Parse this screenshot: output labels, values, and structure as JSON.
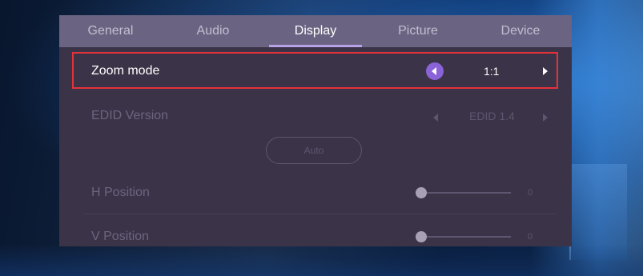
{
  "tabs": [
    {
      "label": "General",
      "active": false
    },
    {
      "label": "Audio",
      "active": false
    },
    {
      "label": "Display",
      "active": true
    },
    {
      "label": "Picture",
      "active": false
    },
    {
      "label": "Device",
      "active": false
    }
  ],
  "zoom_mode": {
    "label": "Zoom mode",
    "value": "1:1"
  },
  "edid": {
    "label": "EDID Version",
    "value": "EDID 1.4"
  },
  "auto_button": {
    "label": "Auto"
  },
  "h_position": {
    "label": "H Position",
    "value": "0"
  },
  "v_position": {
    "label": "V Position",
    "value": "0"
  },
  "colors": {
    "panel_bg": "#3b3347",
    "tab_bar_bg": "#6a6482",
    "tab_active_underline": "#b8a2e6",
    "selector_accent": "#8b63d8",
    "highlight_border": "#e5313a"
  }
}
